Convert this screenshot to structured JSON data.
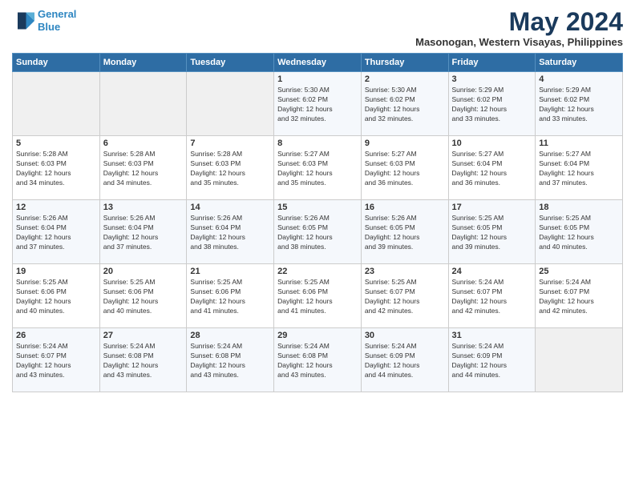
{
  "logo": {
    "line1": "General",
    "line2": "Blue"
  },
  "title": "May 2024",
  "location": "Masonogan, Western Visayas, Philippines",
  "weekdays": [
    "Sunday",
    "Monday",
    "Tuesday",
    "Wednesday",
    "Thursday",
    "Friday",
    "Saturday"
  ],
  "weeks": [
    [
      {
        "day": "",
        "info": ""
      },
      {
        "day": "",
        "info": ""
      },
      {
        "day": "",
        "info": ""
      },
      {
        "day": "1",
        "info": "Sunrise: 5:30 AM\nSunset: 6:02 PM\nDaylight: 12 hours\nand 32 minutes."
      },
      {
        "day": "2",
        "info": "Sunrise: 5:30 AM\nSunset: 6:02 PM\nDaylight: 12 hours\nand 32 minutes."
      },
      {
        "day": "3",
        "info": "Sunrise: 5:29 AM\nSunset: 6:02 PM\nDaylight: 12 hours\nand 33 minutes."
      },
      {
        "day": "4",
        "info": "Sunrise: 5:29 AM\nSunset: 6:02 PM\nDaylight: 12 hours\nand 33 minutes."
      }
    ],
    [
      {
        "day": "5",
        "info": "Sunrise: 5:28 AM\nSunset: 6:03 PM\nDaylight: 12 hours\nand 34 minutes."
      },
      {
        "day": "6",
        "info": "Sunrise: 5:28 AM\nSunset: 6:03 PM\nDaylight: 12 hours\nand 34 minutes."
      },
      {
        "day": "7",
        "info": "Sunrise: 5:28 AM\nSunset: 6:03 PM\nDaylight: 12 hours\nand 35 minutes."
      },
      {
        "day": "8",
        "info": "Sunrise: 5:27 AM\nSunset: 6:03 PM\nDaylight: 12 hours\nand 35 minutes."
      },
      {
        "day": "9",
        "info": "Sunrise: 5:27 AM\nSunset: 6:03 PM\nDaylight: 12 hours\nand 36 minutes."
      },
      {
        "day": "10",
        "info": "Sunrise: 5:27 AM\nSunset: 6:04 PM\nDaylight: 12 hours\nand 36 minutes."
      },
      {
        "day": "11",
        "info": "Sunrise: 5:27 AM\nSunset: 6:04 PM\nDaylight: 12 hours\nand 37 minutes."
      }
    ],
    [
      {
        "day": "12",
        "info": "Sunrise: 5:26 AM\nSunset: 6:04 PM\nDaylight: 12 hours\nand 37 minutes."
      },
      {
        "day": "13",
        "info": "Sunrise: 5:26 AM\nSunset: 6:04 PM\nDaylight: 12 hours\nand 37 minutes."
      },
      {
        "day": "14",
        "info": "Sunrise: 5:26 AM\nSunset: 6:04 PM\nDaylight: 12 hours\nand 38 minutes."
      },
      {
        "day": "15",
        "info": "Sunrise: 5:26 AM\nSunset: 6:05 PM\nDaylight: 12 hours\nand 38 minutes."
      },
      {
        "day": "16",
        "info": "Sunrise: 5:26 AM\nSunset: 6:05 PM\nDaylight: 12 hours\nand 39 minutes."
      },
      {
        "day": "17",
        "info": "Sunrise: 5:25 AM\nSunset: 6:05 PM\nDaylight: 12 hours\nand 39 minutes."
      },
      {
        "day": "18",
        "info": "Sunrise: 5:25 AM\nSunset: 6:05 PM\nDaylight: 12 hours\nand 40 minutes."
      }
    ],
    [
      {
        "day": "19",
        "info": "Sunrise: 5:25 AM\nSunset: 6:06 PM\nDaylight: 12 hours\nand 40 minutes."
      },
      {
        "day": "20",
        "info": "Sunrise: 5:25 AM\nSunset: 6:06 PM\nDaylight: 12 hours\nand 40 minutes."
      },
      {
        "day": "21",
        "info": "Sunrise: 5:25 AM\nSunset: 6:06 PM\nDaylight: 12 hours\nand 41 minutes."
      },
      {
        "day": "22",
        "info": "Sunrise: 5:25 AM\nSunset: 6:06 PM\nDaylight: 12 hours\nand 41 minutes."
      },
      {
        "day": "23",
        "info": "Sunrise: 5:25 AM\nSunset: 6:07 PM\nDaylight: 12 hours\nand 42 minutes."
      },
      {
        "day": "24",
        "info": "Sunrise: 5:24 AM\nSunset: 6:07 PM\nDaylight: 12 hours\nand 42 minutes."
      },
      {
        "day": "25",
        "info": "Sunrise: 5:24 AM\nSunset: 6:07 PM\nDaylight: 12 hours\nand 42 minutes."
      }
    ],
    [
      {
        "day": "26",
        "info": "Sunrise: 5:24 AM\nSunset: 6:07 PM\nDaylight: 12 hours\nand 43 minutes."
      },
      {
        "day": "27",
        "info": "Sunrise: 5:24 AM\nSunset: 6:08 PM\nDaylight: 12 hours\nand 43 minutes."
      },
      {
        "day": "28",
        "info": "Sunrise: 5:24 AM\nSunset: 6:08 PM\nDaylight: 12 hours\nand 43 minutes."
      },
      {
        "day": "29",
        "info": "Sunrise: 5:24 AM\nSunset: 6:08 PM\nDaylight: 12 hours\nand 43 minutes."
      },
      {
        "day": "30",
        "info": "Sunrise: 5:24 AM\nSunset: 6:09 PM\nDaylight: 12 hours\nand 44 minutes."
      },
      {
        "day": "31",
        "info": "Sunrise: 5:24 AM\nSunset: 6:09 PM\nDaylight: 12 hours\nand 44 minutes."
      },
      {
        "day": "",
        "info": ""
      }
    ]
  ]
}
